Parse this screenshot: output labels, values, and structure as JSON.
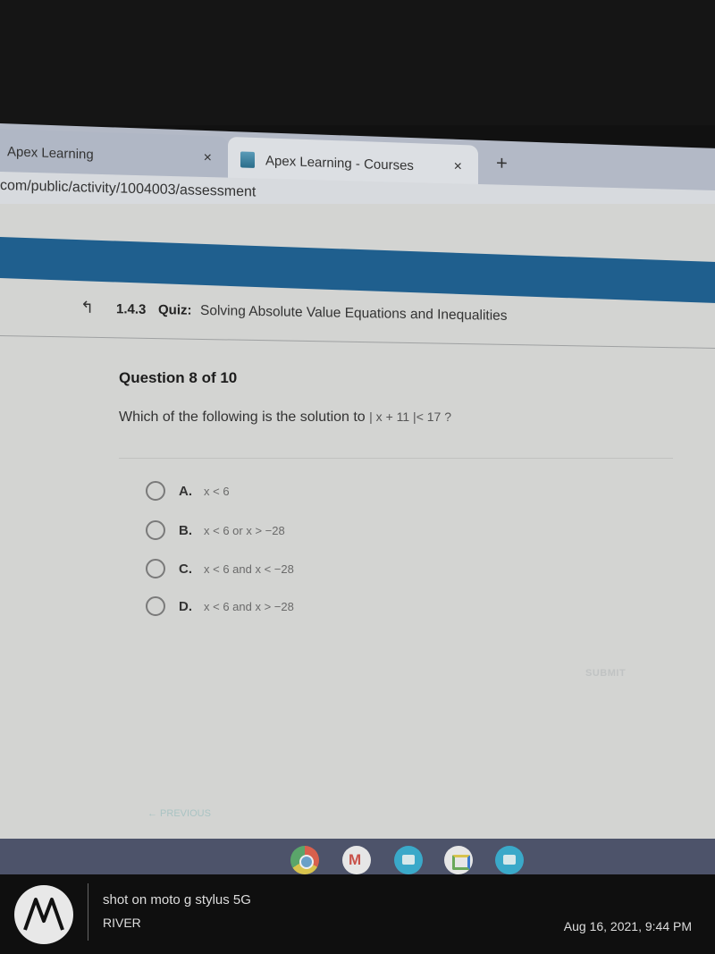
{
  "browser": {
    "tabs": [
      {
        "label": "Apex Learning",
        "active": false
      },
      {
        "label": "Apex Learning - Courses",
        "active": true
      }
    ],
    "close_glyph": "×",
    "new_tab_glyph": "+",
    "url": "com/public/activity/1004003/assessment"
  },
  "header": {
    "back_glyph": "↰",
    "quiz_number": "1.4.3",
    "quiz_label": "Quiz:",
    "quiz_title": "Solving Absolute Value Equations and Inequalities"
  },
  "question": {
    "count": "Question 8 of 10",
    "prompt": "Which of the following is the solution to ",
    "expression": "| x + 11 |< 17 ?",
    "options": [
      {
        "letter": "A.",
        "text": "x < 6"
      },
      {
        "letter": "B.",
        "text": "x < 6 or x > −28"
      },
      {
        "letter": "C.",
        "text": "x < 6  and x < −28"
      },
      {
        "letter": "D.",
        "text": "x < 6  and x > −28"
      }
    ]
  },
  "actions": {
    "submit": "SUBMIT",
    "previous": "← PREVIOUS"
  },
  "shelf": {
    "apps": [
      "chrome",
      "gmail",
      "files",
      "meet",
      "files"
    ]
  },
  "watermark": {
    "line1": "shot on moto g stylus 5G",
    "line2": "RIVER",
    "date": "Aug 16, 2021, 9:44 PM"
  },
  "colors": {
    "accent_band": "#1f5f8e",
    "page_bg": "#d3d4d2",
    "shelf_bg": "#4d536a"
  }
}
